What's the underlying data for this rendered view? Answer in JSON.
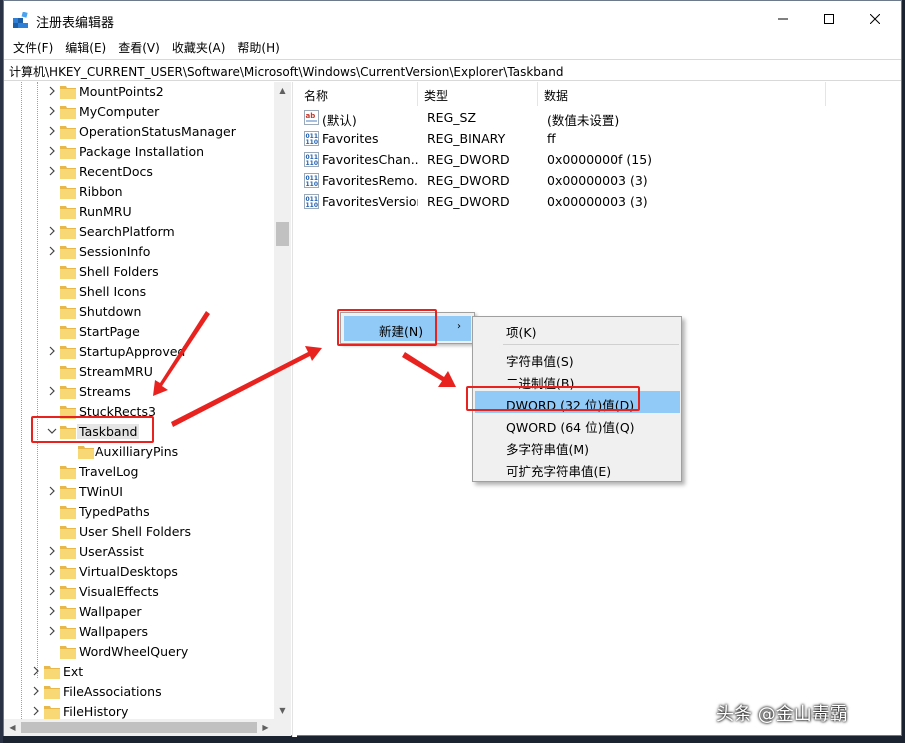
{
  "window": {
    "title": "注册表编辑器",
    "controls": {
      "minimize": "minimize-icon",
      "maximize": "maximize-icon",
      "close": "close-icon"
    }
  },
  "menubar": [
    "文件(F)",
    "编辑(E)",
    "查看(V)",
    "收藏夹(A)",
    "帮助(H)"
  ],
  "address": "计算机\\HKEY_CURRENT_USER\\Software\\Microsoft\\Windows\\CurrentVersion\\Explorer\\Taskband",
  "tree": {
    "items": [
      {
        "label": "MountPoints2",
        "expandable": true
      },
      {
        "label": "MyComputer",
        "expandable": true
      },
      {
        "label": "OperationStatusManager",
        "expandable": true
      },
      {
        "label": "Package Installation",
        "expandable": true
      },
      {
        "label": "RecentDocs",
        "expandable": true
      },
      {
        "label": "Ribbon",
        "expandable": false
      },
      {
        "label": "RunMRU",
        "expandable": false
      },
      {
        "label": "SearchPlatform",
        "expandable": true
      },
      {
        "label": "SessionInfo",
        "expandable": true
      },
      {
        "label": "Shell Folders",
        "expandable": false
      },
      {
        "label": "Shell Icons",
        "expandable": false
      },
      {
        "label": "Shutdown",
        "expandable": false
      },
      {
        "label": "StartPage",
        "expandable": false
      },
      {
        "label": "StartupApproved",
        "expandable": true
      },
      {
        "label": "StreamMRU",
        "expandable": false
      },
      {
        "label": "Streams",
        "expandable": true
      },
      {
        "label": "StuckRects3",
        "expandable": false
      },
      {
        "label": "Taskband",
        "expandable": true,
        "expanded": true,
        "selected": true
      },
      {
        "label": "AuxilliaryPins",
        "expandable": false,
        "child": true
      },
      {
        "label": "TravelLog",
        "expandable": false
      },
      {
        "label": "TWinUI",
        "expandable": true
      },
      {
        "label": "TypedPaths",
        "expandable": false
      },
      {
        "label": "User Shell Folders",
        "expandable": false
      },
      {
        "label": "UserAssist",
        "expandable": true
      },
      {
        "label": "VirtualDesktops",
        "expandable": true
      },
      {
        "label": "VisualEffects",
        "expandable": true
      },
      {
        "label": "Wallpaper",
        "expandable": true
      },
      {
        "label": "Wallpapers",
        "expandable": true
      },
      {
        "label": "WordWheelQuery",
        "expandable": false
      },
      {
        "label": "Ext",
        "expandable": true,
        "upper": true
      },
      {
        "label": "FileAssociations",
        "expandable": true,
        "upper": true
      },
      {
        "label": "FileHistory",
        "expandable": true,
        "upper": true
      }
    ]
  },
  "list": {
    "columns": [
      "名称",
      "类型",
      "数据"
    ],
    "rows": [
      {
        "icon": "string-value-icon",
        "name": "(默认)",
        "type": "REG_SZ",
        "data": "(数值未设置)"
      },
      {
        "icon": "binary-value-icon",
        "name": "Favorites",
        "type": "REG_BINARY",
        "data": "ff"
      },
      {
        "icon": "binary-value-icon",
        "name": "FavoritesChan...",
        "type": "REG_DWORD",
        "data": "0x0000000f (15)"
      },
      {
        "icon": "binary-value-icon",
        "name": "FavoritesRemo...",
        "type": "REG_DWORD",
        "data": "0x00000003 (3)"
      },
      {
        "icon": "binary-value-icon",
        "name": "FavoritesVersion",
        "type": "REG_DWORD",
        "data": "0x00000003 (3)"
      }
    ]
  },
  "context_menu": {
    "new_label": "新建(N)",
    "arrow": "›",
    "submenu": {
      "key": "项(K)",
      "string": "字符串值(S)",
      "binary": "二进制值(B)",
      "dword": "DWORD (32 位)值(D)",
      "qword": "QWORD (64 位)值(Q)",
      "multi": "多字符串值(M)",
      "expand": "可扩充字符串值(E)"
    }
  },
  "annotation_color": "#e8231f",
  "watermark": "头条 @金山毒霸"
}
